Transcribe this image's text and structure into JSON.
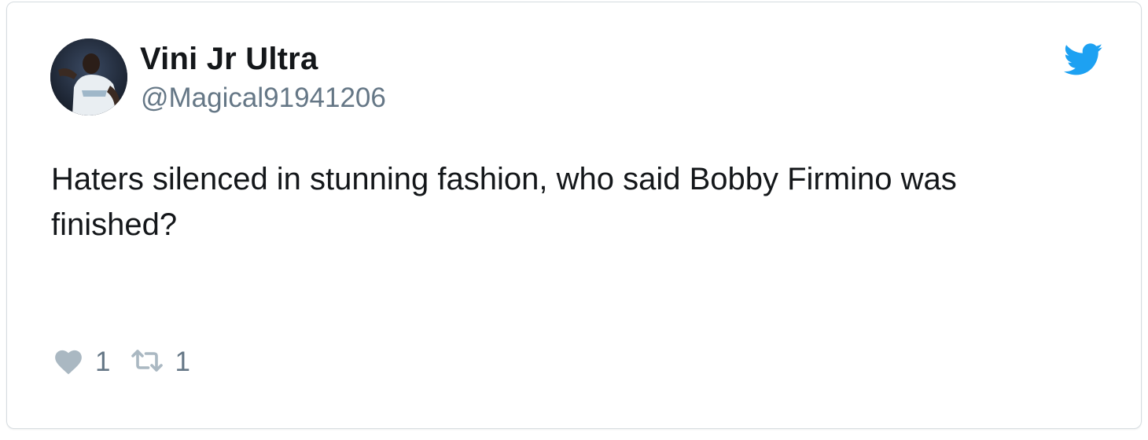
{
  "tweet": {
    "author": {
      "display_name": "Vini Jr Ultra",
      "handle": "@Magical91941206",
      "avatar_icon": "profile-photo"
    },
    "text": "Haters silenced in stunning fashion, who said Bobby Firmino was finished?",
    "brand_icon": "twitter-bird-icon",
    "likes": {
      "icon": "heart-icon",
      "count": "1"
    },
    "retweets": {
      "icon": "retweet-icon",
      "count": "1"
    }
  },
  "colors": {
    "brand": "#1da1f2",
    "text_primary": "#14171a",
    "text_secondary": "#657786",
    "icon_muted": "#aab8c2",
    "border": "#d6dce0"
  }
}
